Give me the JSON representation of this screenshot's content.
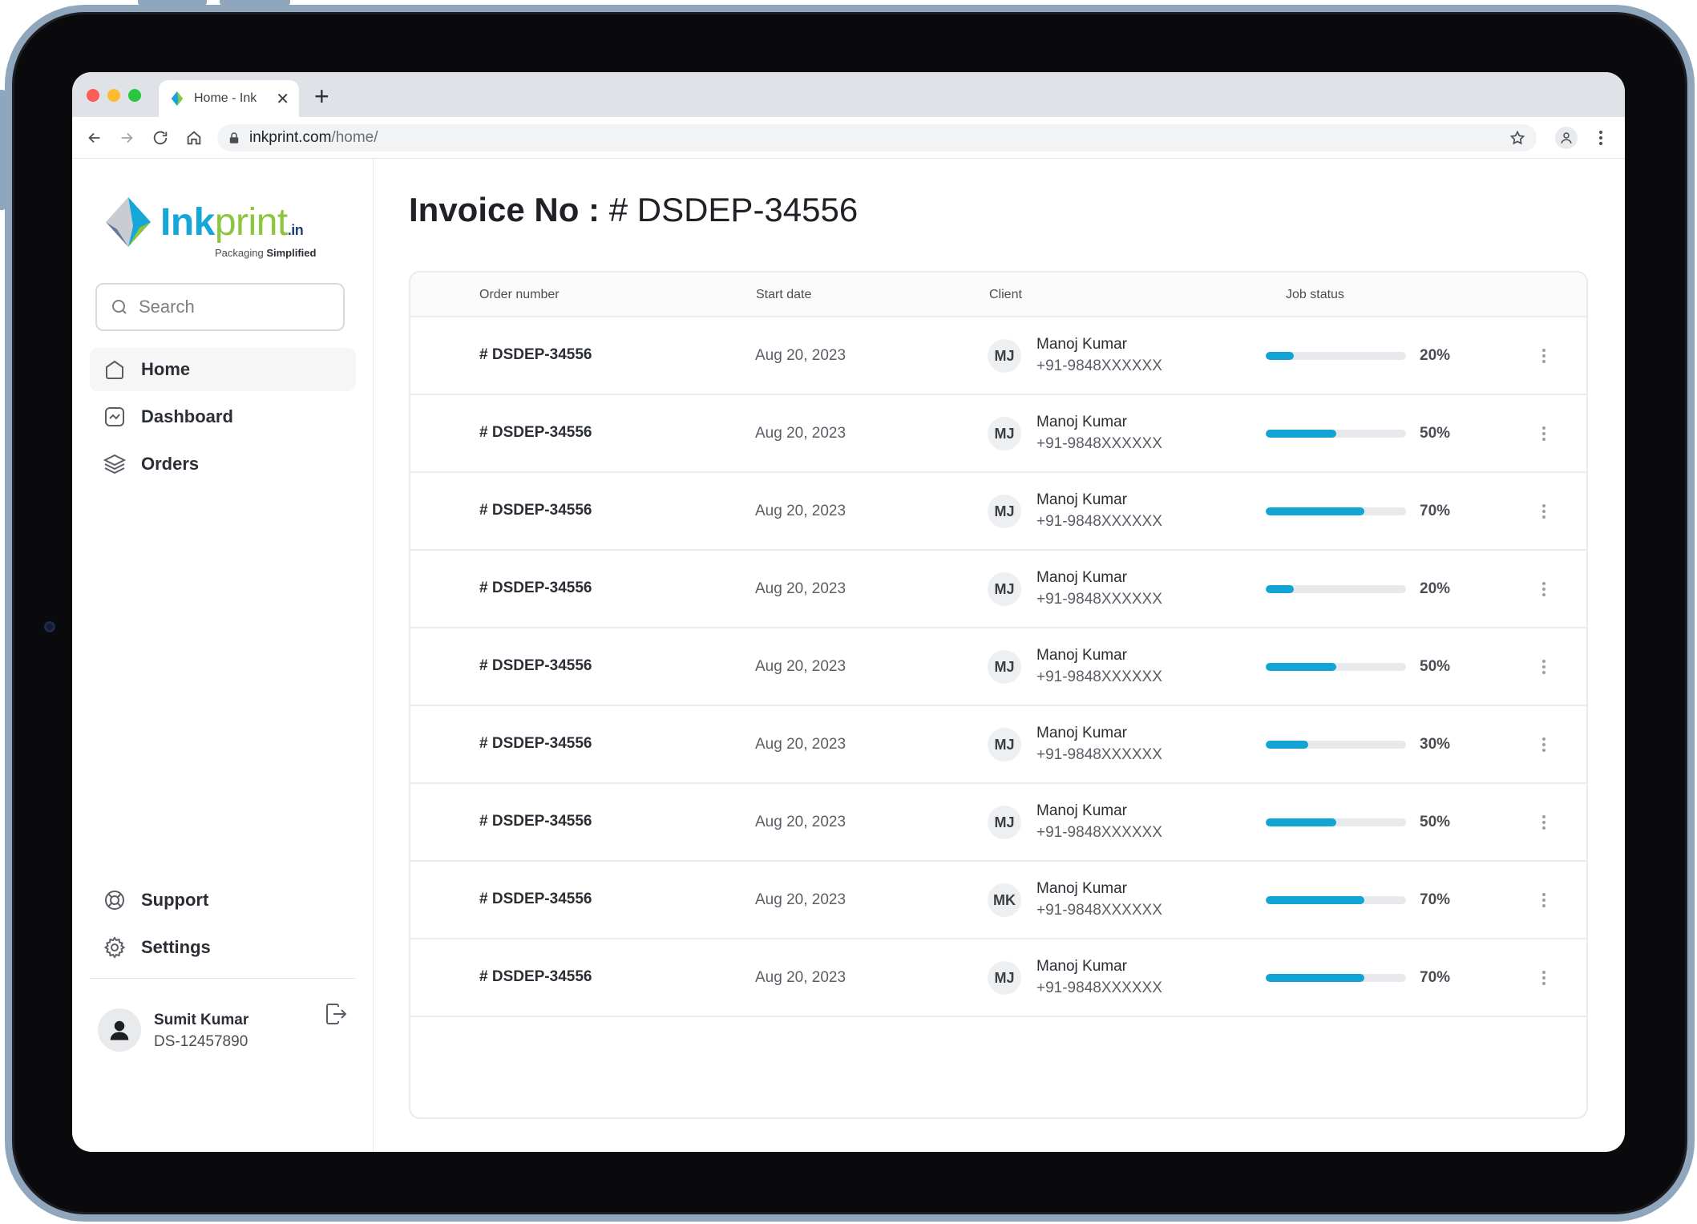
{
  "browser": {
    "tab_title": "Home - Ink",
    "tab_close": "✕",
    "new_tab": "+",
    "url_host": "inkprint.com",
    "url_path": "/home/"
  },
  "brand": {
    "name_part1": "Ink",
    "name_part2": "print",
    "tld": ".in",
    "tagline_part1": "Packaging ",
    "tagline_part2": "Simplified",
    "colors": {
      "blue": "#16a7d8",
      "green": "#8cc63e",
      "navy": "#1f3f7a"
    }
  },
  "sidebar": {
    "search_placeholder": "Search",
    "nav": [
      {
        "label": "Home",
        "icon": "home-icon",
        "active": true
      },
      {
        "label": "Dashboard",
        "icon": "chart-icon",
        "active": false
      },
      {
        "label": "Orders",
        "icon": "layers-icon",
        "active": false
      }
    ],
    "bottom_nav": [
      {
        "label": "Support",
        "icon": "lifebuoy-icon"
      },
      {
        "label": "Settings",
        "icon": "gear-icon"
      }
    ],
    "user": {
      "name": "Sumit Kumar",
      "id": "DS-12457890"
    }
  },
  "main": {
    "title_label": "Invoice No :",
    "title_value": " # DSDEP-34556",
    "table": {
      "columns": [
        "Order number",
        "Start date",
        "Client",
        "Job status"
      ],
      "progress_color": "#11a4d5",
      "rows": [
        {
          "order": "# DSDEP-34556",
          "date": "Aug 20, 2023",
          "initials": "MJ",
          "client": "Manoj Kumar",
          "phone": "+91-9848XXXXXX",
          "progress": 20,
          "progress_label": "20%"
        },
        {
          "order": "# DSDEP-34556",
          "date": "Aug 20, 2023",
          "initials": "MJ",
          "client": "Manoj Kumar",
          "phone": "+91-9848XXXXXX",
          "progress": 50,
          "progress_label": "50%"
        },
        {
          "order": "# DSDEP-34556",
          "date": "Aug 20, 2023",
          "initials": "MJ",
          "client": "Manoj Kumar",
          "phone": "+91-9848XXXXXX",
          "progress": 70,
          "progress_label": "70%"
        },
        {
          "order": "# DSDEP-34556",
          "date": "Aug 20, 2023",
          "initials": "MJ",
          "client": "Manoj Kumar",
          "phone": "+91-9848XXXXXX",
          "progress": 20,
          "progress_label": "20%"
        },
        {
          "order": "# DSDEP-34556",
          "date": "Aug 20, 2023",
          "initials": "MJ",
          "client": "Manoj Kumar",
          "phone": "+91-9848XXXXXX",
          "progress": 50,
          "progress_label": "50%"
        },
        {
          "order": "# DSDEP-34556",
          "date": "Aug 20, 2023",
          "initials": "MJ",
          "client": "Manoj Kumar",
          "phone": "+91-9848XXXXXX",
          "progress": 30,
          "progress_label": "30%"
        },
        {
          "order": "# DSDEP-34556",
          "date": "Aug 20, 2023",
          "initials": "MJ",
          "client": "Manoj Kumar",
          "phone": "+91-9848XXXXXX",
          "progress": 50,
          "progress_label": "50%"
        },
        {
          "order": "# DSDEP-34556",
          "date": "Aug 20, 2023",
          "initials": "MK",
          "client": "Manoj Kumar",
          "phone": "+91-9848XXXXXX",
          "progress": 70,
          "progress_label": "70%"
        },
        {
          "order": "# DSDEP-34556",
          "date": "Aug 20, 2023",
          "initials": "MJ",
          "client": "Manoj Kumar",
          "phone": "+91-9848XXXXXX",
          "progress": 70,
          "progress_label": "70%"
        }
      ]
    }
  }
}
